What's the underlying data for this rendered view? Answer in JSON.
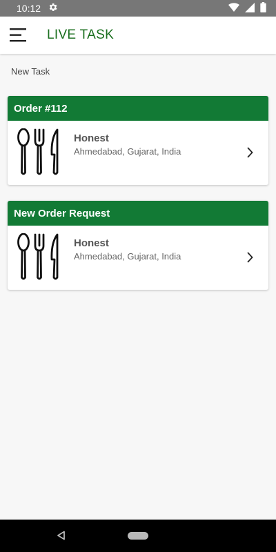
{
  "status_bar": {
    "time": "10:12",
    "icons": [
      "gear-icon",
      "wifi-icon",
      "signal-icon",
      "battery-icon"
    ]
  },
  "app_bar": {
    "title": "LIVE TASK",
    "menu_icon": "hamburger-menu-icon"
  },
  "section": {
    "label": "New Task"
  },
  "tasks": [
    {
      "header": "Order #112",
      "name": "Honest",
      "address": "Ahmedabad, Gujarat, India",
      "icon": "cutlery-icon",
      "action_icon": "chevron-right-icon"
    },
    {
      "header": "New Order Request",
      "name": "Honest",
      "address": "Ahmedabad, Gujarat, India",
      "icon": "cutlery-icon",
      "action_icon": "chevron-right-icon"
    }
  ],
  "nav_bar": {
    "icons": [
      "back-icon",
      "home-pill-icon"
    ]
  },
  "colors": {
    "primary_green": "#127a35",
    "title_green": "#1b6f1f",
    "status_bar_bg": "#777777",
    "page_bg": "#f7f7f7"
  }
}
